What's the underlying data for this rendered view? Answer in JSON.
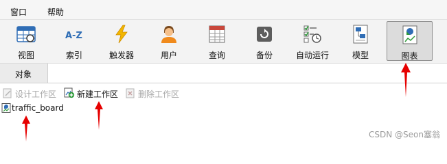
{
  "menubar": {
    "items": [
      "窗口",
      "帮助"
    ]
  },
  "toolbar": {
    "items": [
      {
        "label": "视图",
        "icon": "grid-view-icon"
      },
      {
        "label": "索引",
        "icon": "az-index-icon"
      },
      {
        "label": "触发器",
        "icon": "lightning-icon"
      },
      {
        "label": "用户",
        "icon": "user-icon"
      },
      {
        "label": "查询",
        "icon": "query-table-icon"
      },
      {
        "label": "备份",
        "icon": "backup-icon"
      },
      {
        "label": "自动运行",
        "icon": "schedule-icon"
      },
      {
        "label": "模型",
        "icon": "model-icon"
      },
      {
        "label": "图表",
        "icon": "chart-icon",
        "active": true
      }
    ]
  },
  "tabs": {
    "objects_label": "对象"
  },
  "workspace_bar": {
    "design_label": "设计工作区",
    "new_label": "新建工作区",
    "delete_label": "删除工作区"
  },
  "list": {
    "items": [
      {
        "name": "traffic_board",
        "icon": "chart-file-icon"
      }
    ]
  },
  "watermark": "CSDN @Seon塞翁",
  "colors": {
    "annotation_arrow": "#e60000",
    "accent_blue": "#2f7fd2"
  }
}
